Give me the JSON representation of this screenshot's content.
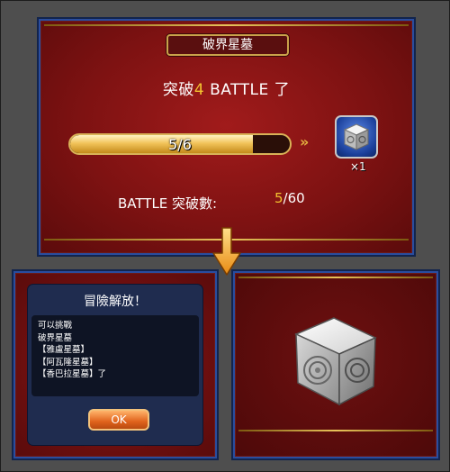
{
  "top_panel": {
    "title": "破界星墓",
    "headline_prefix": "突破",
    "headline_count": "4",
    "headline_suffix": " BATTLE 了",
    "progress": {
      "label": "5/6",
      "current": 5,
      "total": 6
    },
    "arrows": "»",
    "reward": {
      "icon": "silver-cube-icon",
      "quantity": "×1"
    },
    "stat_label": "BATTLE 突破數:",
    "stat_current": "5",
    "stat_total": "/60"
  },
  "dialog": {
    "title": "冒險解放！",
    "lines": [
      "可以挑戰",
      "破界星墓",
      "【雅盧星墓】",
      "【阿瓦隆星墓】",
      "【香巴拉星墓】了"
    ],
    "ok_label": "OK"
  },
  "reward_preview": {
    "icon": "silver-cube-icon"
  },
  "colors": {
    "gold": "#f2c330",
    "panel_red": "#7e1212",
    "panel_border": "#2a4d9e",
    "ok_orange": "#e0631c"
  }
}
